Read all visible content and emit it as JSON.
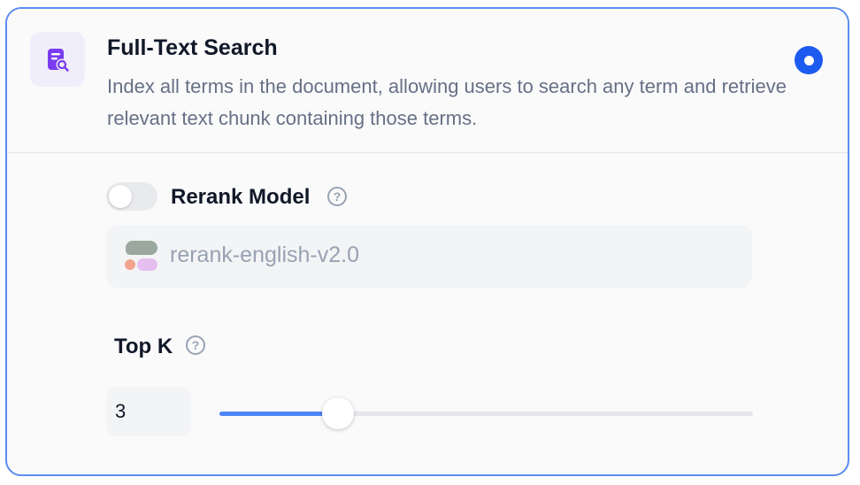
{
  "option": {
    "icon": "document-search-icon",
    "title": "Full-Text Search",
    "description": "Index all terms in the document, allowing users to search any term and retrieve relevant text chunk containing those terms.",
    "selected": true,
    "accent_color": "#1d5af0"
  },
  "rerank": {
    "label": "Rerank Model",
    "enabled": false,
    "help_icon": "question-circle-icon",
    "model_name": "rerank-english-v2.0",
    "model_icon": "cohere-logo-icon"
  },
  "top_k": {
    "label": "Top K",
    "help_icon": "question-circle-icon",
    "value": "3",
    "slider_value": 3,
    "slider_min": 1,
    "slider_max": 10
  }
}
